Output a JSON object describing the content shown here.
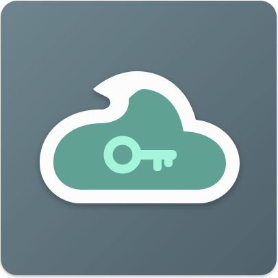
{
  "app_icon": {
    "icon": "cloud-key-icon",
    "colors": {
      "background_light": "#6F858E",
      "background_dark": "#4F626B",
      "cloud_outline": "#FCFCFC",
      "cloud_fill": "#5EA193",
      "key": "#A5F5DA"
    }
  }
}
